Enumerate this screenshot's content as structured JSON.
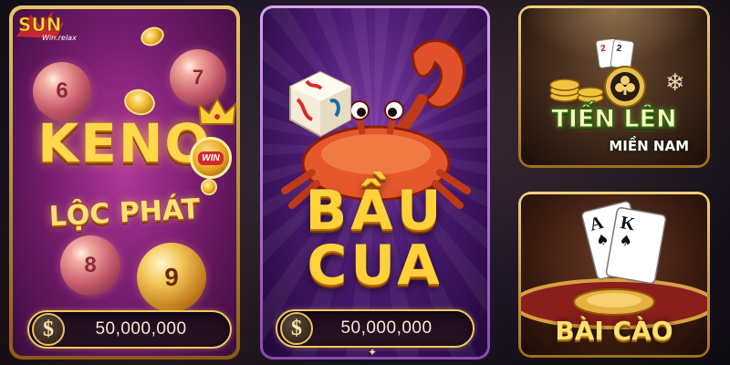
{
  "brand": {
    "logo_text": "SUN",
    "logo_sub": "Win.relax"
  },
  "games": {
    "keno": {
      "title": "KENO",
      "subtitle": "LỘC PHÁT",
      "badge": "WIN",
      "balls": [
        "6",
        "7",
        "8",
        "9"
      ],
      "currency_symbol": "$",
      "jackpot": "50,000,000"
    },
    "baucua": {
      "title_line1": "BẦU",
      "title_line2": "CUA",
      "currency_symbol": "$",
      "jackpot": "50,000,000"
    },
    "tienlen": {
      "title": "TIẾN LÊN",
      "subtitle": "MIỀN NAM",
      "card_ranks": [
        "2",
        "2"
      ]
    },
    "baicao": {
      "title": "BÀI CÀO",
      "card_ranks": [
        "A",
        "K"
      ]
    }
  },
  "colors": {
    "gold": "#ffd23a",
    "keno_bg": "#7a1e72",
    "baucua_bg": "#4a1a70",
    "tienlen_green_stroke": "#2a6a10"
  }
}
